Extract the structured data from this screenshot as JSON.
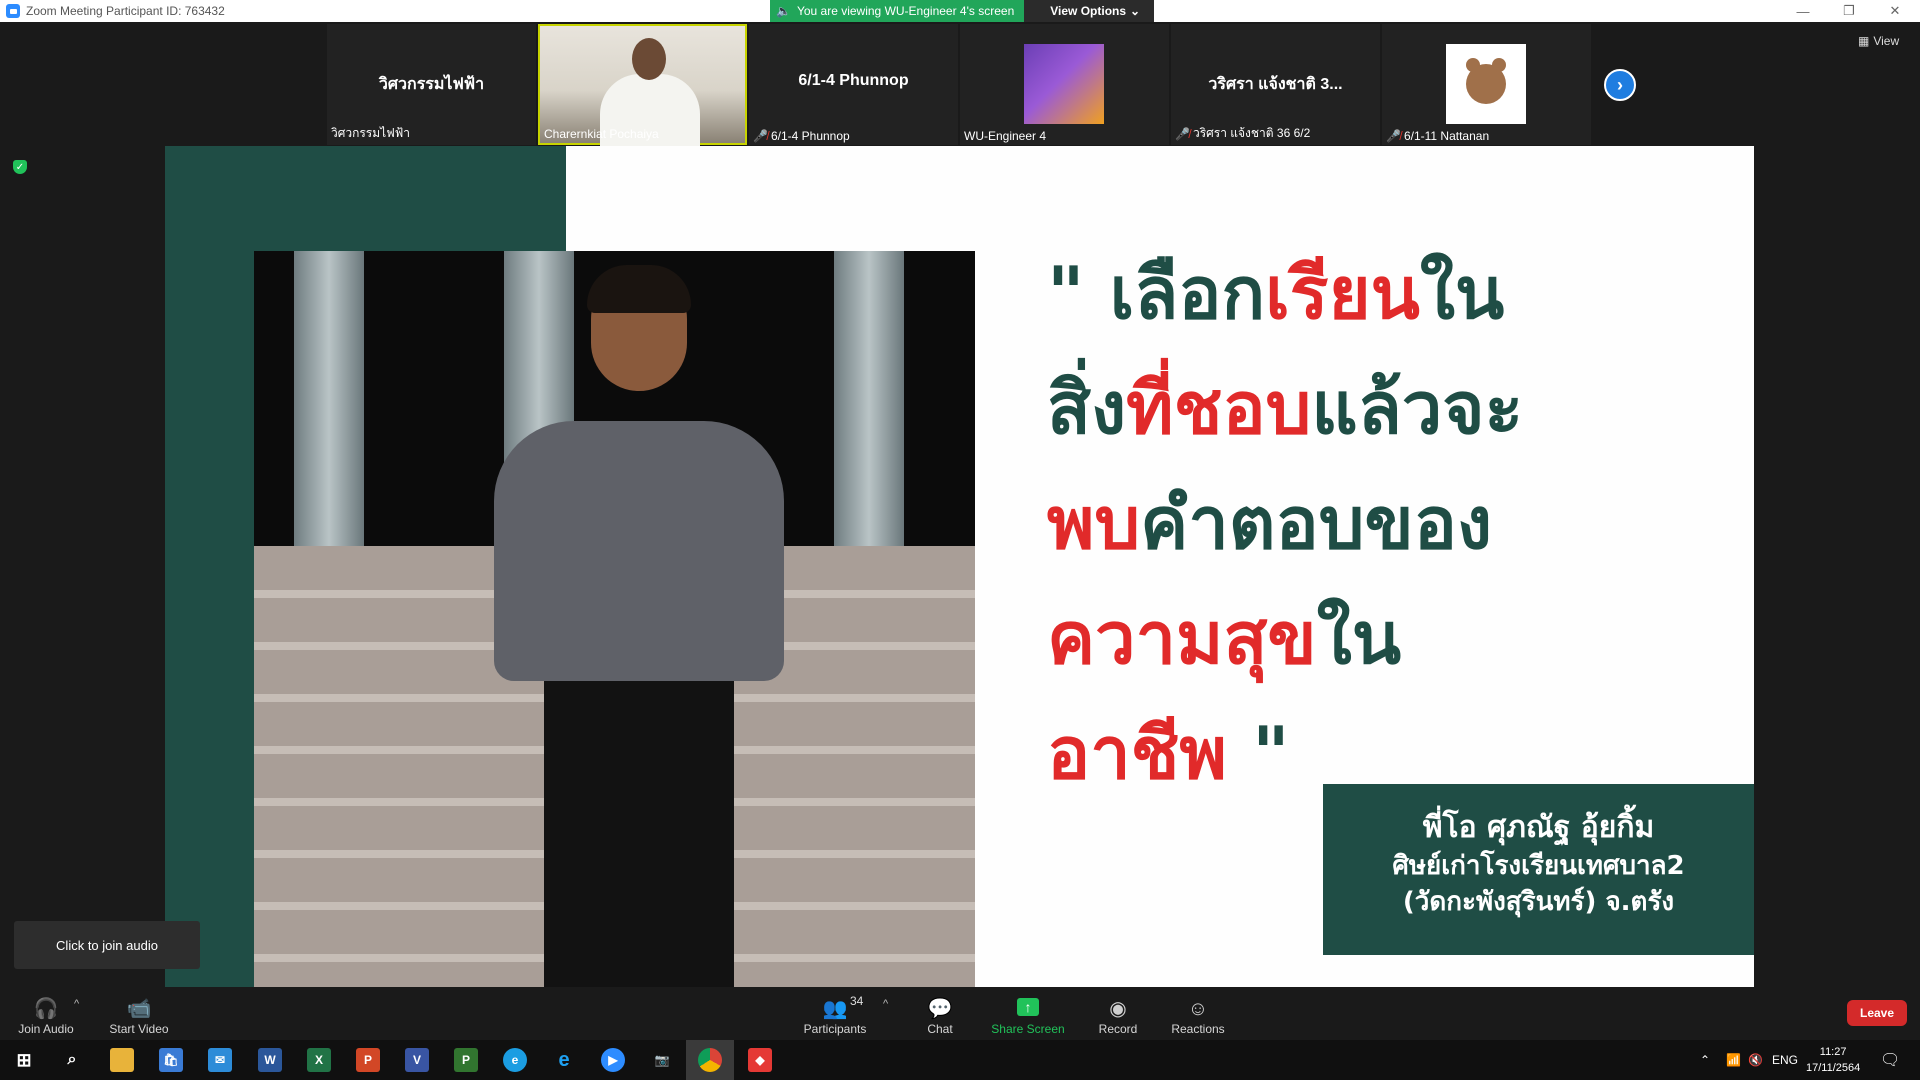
{
  "window": {
    "title": "Zoom Meeting Participant ID: 763432"
  },
  "banner": {
    "viewing_text": "You are viewing WU-Engineer 4's screen",
    "options_label": "View Options"
  },
  "thumbnails": [
    {
      "center_name": "วิศวกรรมไฟฟ้า",
      "label": "วิศวกรรมไฟฟ้า",
      "muted": false,
      "kind": "name"
    },
    {
      "center_name": "",
      "label": "Charernkiat Pochaiya",
      "muted": false,
      "kind": "video"
    },
    {
      "center_name": "6/1-4 Phunnop",
      "label": "6/1-4 Phunnop",
      "muted": true,
      "kind": "name"
    },
    {
      "center_name": "",
      "label": "WU-Engineer 4",
      "muted": false,
      "kind": "poster"
    },
    {
      "center_name": "วริศรา แจ้งชาติ 3...",
      "label": "วริศรา แจ้งชาติ 36 6/2",
      "muted": true,
      "kind": "name"
    },
    {
      "center_name": "",
      "label": "6/1-11 Nattanan",
      "muted": true,
      "kind": "bear"
    }
  ],
  "view_label": "View",
  "slide": {
    "quote_lines": [
      [
        {
          "t": "\" เลือก",
          "red": false
        },
        {
          "t": "เรียน",
          "red": true
        },
        {
          "t": "ใน",
          "red": false
        }
      ],
      [
        {
          "t": "สิ่ง",
          "red": false
        },
        {
          "t": "ที่ชอบ",
          "red": true
        },
        {
          "t": "แล้วจะ",
          "red": false
        }
      ],
      [
        {
          "t": "พบ",
          "red": true
        },
        {
          "t": "คำตอบของ",
          "red": false
        }
      ],
      [
        {
          "t": "ความสุข",
          "red": true
        },
        {
          "t": "ใน",
          "red": false
        }
      ],
      [
        {
          "t": "อาชีพ",
          "red": true
        },
        {
          "t": "  \"",
          "red": false
        }
      ]
    ],
    "caption_name": "พี่โอ ศุภณัฐ อุ้ยกิ้ม",
    "caption_line1": "ศิษย์เก่าโรงเรียนเทศบาล2",
    "caption_line2": "(วัดกะพังสุรินทร์) จ.ตรัง",
    "colors": {
      "green": "#1f4d45",
      "red": "#e12a2a"
    }
  },
  "tooltip": "Click to join audio",
  "controls": {
    "join_audio": "Join Audio",
    "start_video": "Start Video",
    "participants": "Participants",
    "participants_count": "34",
    "chat": "Chat",
    "share_screen": "Share Screen",
    "record": "Record",
    "reactions": "Reactions",
    "leave": "Leave"
  },
  "taskbar": {
    "language": "ENG",
    "time": "11:27",
    "date": "17/11/2564",
    "apps": [
      "start-icon",
      "search-icon",
      "file-explorer-icon",
      "store-icon",
      "mail-icon",
      "word-icon",
      "excel-icon",
      "powerpoint-icon",
      "visio-icon",
      "project-icon",
      "edge-icon",
      "internet-explorer-icon",
      "zoom-icon",
      "camera-icon",
      "chrome-icon",
      "anydesk-icon"
    ]
  }
}
